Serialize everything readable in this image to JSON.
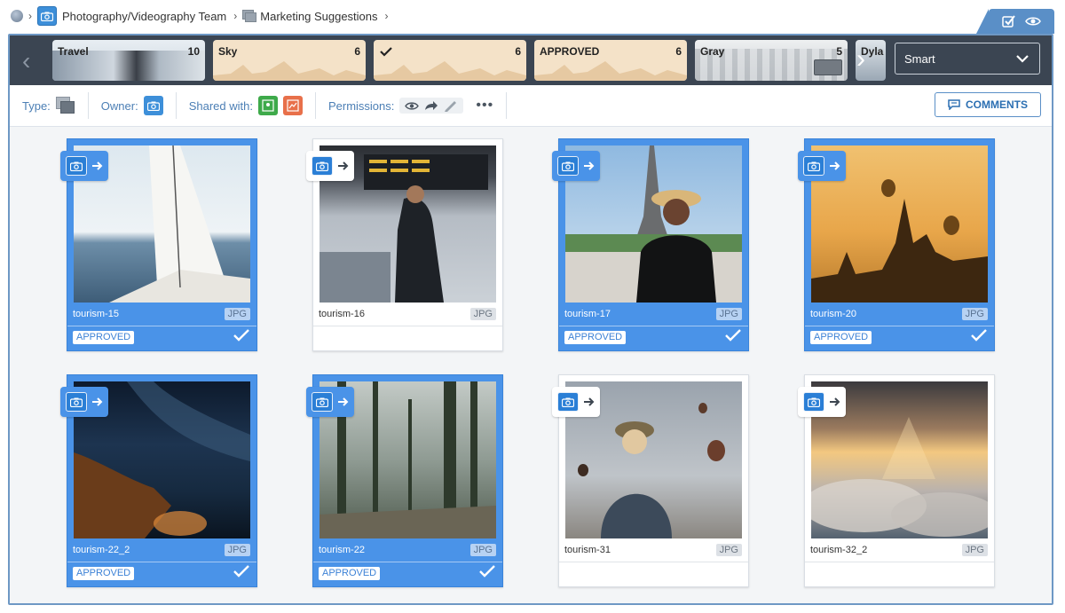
{
  "breadcrumb": {
    "items": [
      "Photography/Videography Team",
      "Marketing Suggestions"
    ]
  },
  "filters": {
    "chips": [
      {
        "label": "Travel",
        "count": "10"
      },
      {
        "label": "Sky",
        "count": "6"
      },
      {
        "label": "",
        "count": "6",
        "icon": "checkmark-icon"
      },
      {
        "label": "APPROVED",
        "count": "6"
      },
      {
        "label": "Gray",
        "count": "5"
      },
      {
        "label": "Dyla",
        "count": ""
      }
    ],
    "sort": {
      "value": "Smart"
    }
  },
  "meta": {
    "type_label": "Type:",
    "owner_label": "Owner:",
    "shared_label": "Shared with:",
    "permissions_label": "Permissions:",
    "comments_label": "COMMENTS"
  },
  "assets": [
    {
      "name": "tourism-15",
      "ext": "JPG",
      "selected": true,
      "status": "APPROVED"
    },
    {
      "name": "tourism-16",
      "ext": "JPG",
      "selected": false,
      "status": ""
    },
    {
      "name": "tourism-17",
      "ext": "JPG",
      "selected": true,
      "status": "APPROVED"
    },
    {
      "name": "tourism-20",
      "ext": "JPG",
      "selected": true,
      "status": "APPROVED"
    },
    {
      "name": "tourism-22_2",
      "ext": "JPG",
      "selected": true,
      "status": "APPROVED"
    },
    {
      "name": "tourism-22",
      "ext": "JPG",
      "selected": true,
      "status": "APPROVED"
    },
    {
      "name": "tourism-31",
      "ext": "JPG",
      "selected": false,
      "status": ""
    },
    {
      "name": "tourism-32_2",
      "ext": "JPG",
      "selected": false,
      "status": ""
    }
  ],
  "colors": {
    "accent": "#4a93e8",
    "strip": "#3b4552",
    "frame": "#6e98c5"
  }
}
